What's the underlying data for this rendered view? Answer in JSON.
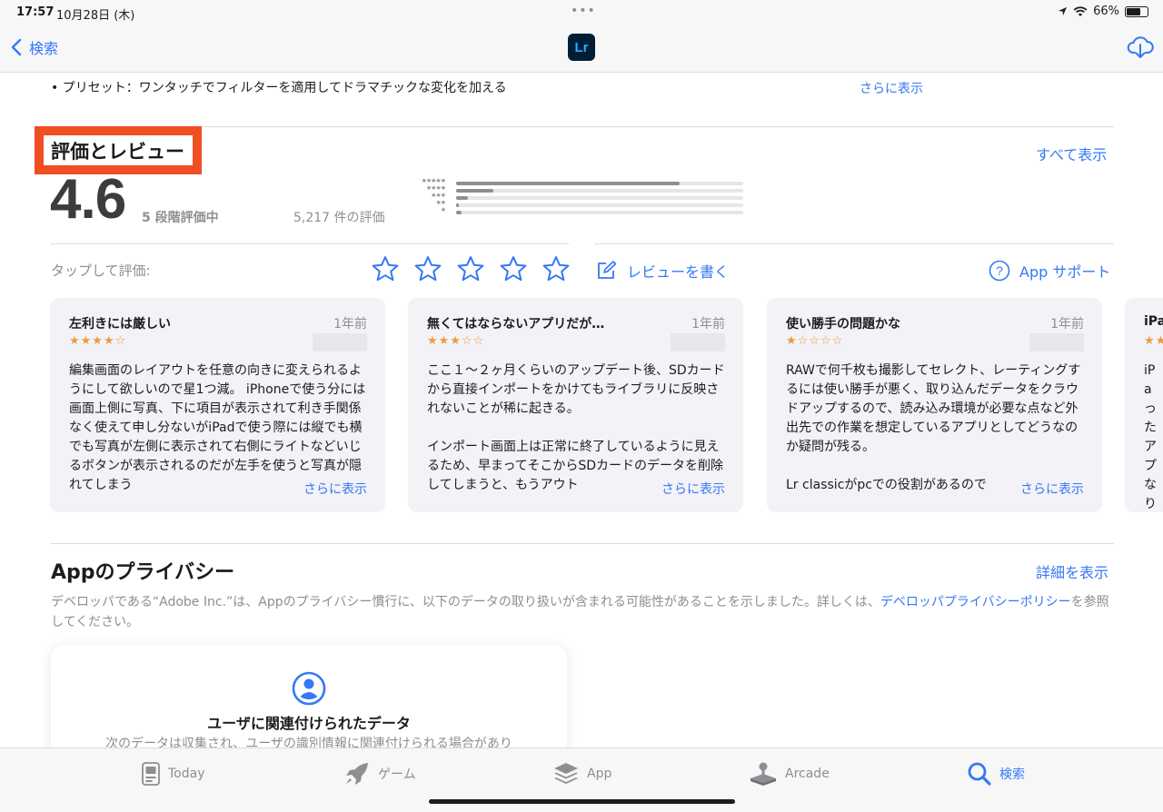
{
  "status_bar": {
    "time": "17:57",
    "date": "10月28日 (木)",
    "battery": "66%"
  },
  "nav": {
    "back_label": "検索",
    "app_icon_label": "Lr"
  },
  "description": {
    "preset_line": "• プリセット：ワンタッチでフィルターを適用してドラマチックな変化を加える",
    "more": "さらに表示"
  },
  "ratings": {
    "title": "評価とレビュー",
    "see_all": "すべて表示",
    "score": "4.6",
    "out_of": "5 段階評価中",
    "count": "5,217 件の評価",
    "histogram": [
      {
        "stars": "★★★★★",
        "fraction": 0.78
      },
      {
        "stars": "★★★★",
        "fraction": 0.13
      },
      {
        "stars": "★★★",
        "fraction": 0.04
      },
      {
        "stars": "★★",
        "fraction": 0.01
      },
      {
        "stars": "★",
        "fraction": 0.02
      }
    ],
    "tap_label": "タップして評価:",
    "write_review": "レビューを書く",
    "app_support": "App サポート"
  },
  "reviews": [
    {
      "title": "左利きには厳しい",
      "date": "1年前",
      "stars": "★★★★☆",
      "body": [
        "編集画面のレイアウトを任意の向きに変えられるようにして欲しいので星1つ減。 iPhoneで使う分には画面上側に写真、下に項目が表示されて利き手関係なく使えて申し分ないがiPadで使う際には縦でも横でも写真が左側に表示されて右側にライトなどいじるボタンが表示されるのだが左手を使うと写真が隠れてしまう"
      ],
      "more": "さらに表示"
    },
    {
      "title": "無くてはならないアプリだが…",
      "date": "1年前",
      "stars": "★★★☆☆",
      "body": [
        "ここ１〜２ヶ月くらいのアップデート後、SDカードから直接インポートをかけてもライブラリに反映されないことが稀に起きる。",
        "インポート画面上は正常に終了しているように見えるため、早まってそこからSDカードのデータを削除してしまうと、もうアウト"
      ],
      "more": "さらに表示"
    },
    {
      "title": "使い勝手の問題かな",
      "date": "1年前",
      "stars": "★☆☆☆☆",
      "body": [
        "RAWで何千枚も撮影してセレクト、レーティングするには使い勝手が悪く、取り込んだデータをクラウドアップするので、読み込み環境が必要な点など外出先での作業を想定しているアプリとしてどうなのか疑問が残る。",
        "Lr classicがpcでの役割があるので"
      ],
      "more": "さらに表示"
    },
    {
      "title": "iPa",
      "date": "",
      "stars": "★★",
      "body": [
        "iPa った アプ なり 出る あと てい"
      ],
      "more": ""
    }
  ],
  "privacy": {
    "title": "Appのプライバシー",
    "details": "詳細を表示",
    "desc_prefix": "デベロッパである“Adobe Inc.”は、Appのプライバシー慣行に、以下のデータの取り扱いが含まれる可能性があることを示しました。詳しくは、",
    "desc_link": "デベロッパプライバシーポリシー",
    "desc_suffix": "を参照してください。",
    "card_title": "ユーザに関連付けられたデータ",
    "card_desc": "次のデータは収集され、ユーザの識別情報に関連付けられる場合があり"
  },
  "tabs": [
    {
      "label": "Today",
      "icon": "today-icon"
    },
    {
      "label": "ゲーム",
      "icon": "rocket-icon"
    },
    {
      "label": "App",
      "icon": "layers-icon"
    },
    {
      "label": "Arcade",
      "icon": "joystick-icon"
    },
    {
      "label": "検索",
      "icon": "search-icon"
    }
  ],
  "colors": {
    "accent": "#3478f6",
    "highlight_box": "#f04e23",
    "star": "#f09a37"
  }
}
